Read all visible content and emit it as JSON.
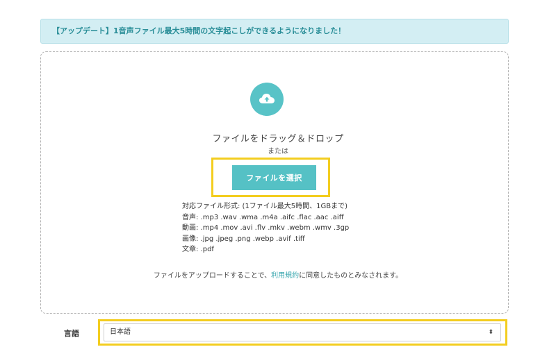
{
  "banner": {
    "text": "【アップデート】1音声ファイル最大5時間の文字起こしができるようになりました！"
  },
  "upload": {
    "icon": "cloud-upload-icon",
    "drag_text": "ファイルをドラッグ＆ドロップ",
    "or_text": "または",
    "select_button": "ファイルを選択",
    "formats": [
      "対応ファイル形式: (1ファイル最大5時間、1GBまで)",
      "音声: .mp3 .wav .wma .m4a .aifc .flac .aac .aiff",
      "動画: .mp4 .mov .avi .flv .mkv .webm .wmv .3gp",
      "画像: .jpg .jpeg .png .webp .avif .tiff",
      "文章: .pdf"
    ],
    "terms_prefix": "ファイルをアップロードすることで、",
    "terms_link": "利用規約",
    "terms_suffix": "に同意したものとみなされます。"
  },
  "language": {
    "label": "言語",
    "selected": "日本語",
    "arrows": "⬍"
  },
  "colors": {
    "accent": "#55c1c5",
    "highlight": "#f3cd1f",
    "banner_bg": "#d3eef3",
    "banner_text": "#2a8e98"
  }
}
